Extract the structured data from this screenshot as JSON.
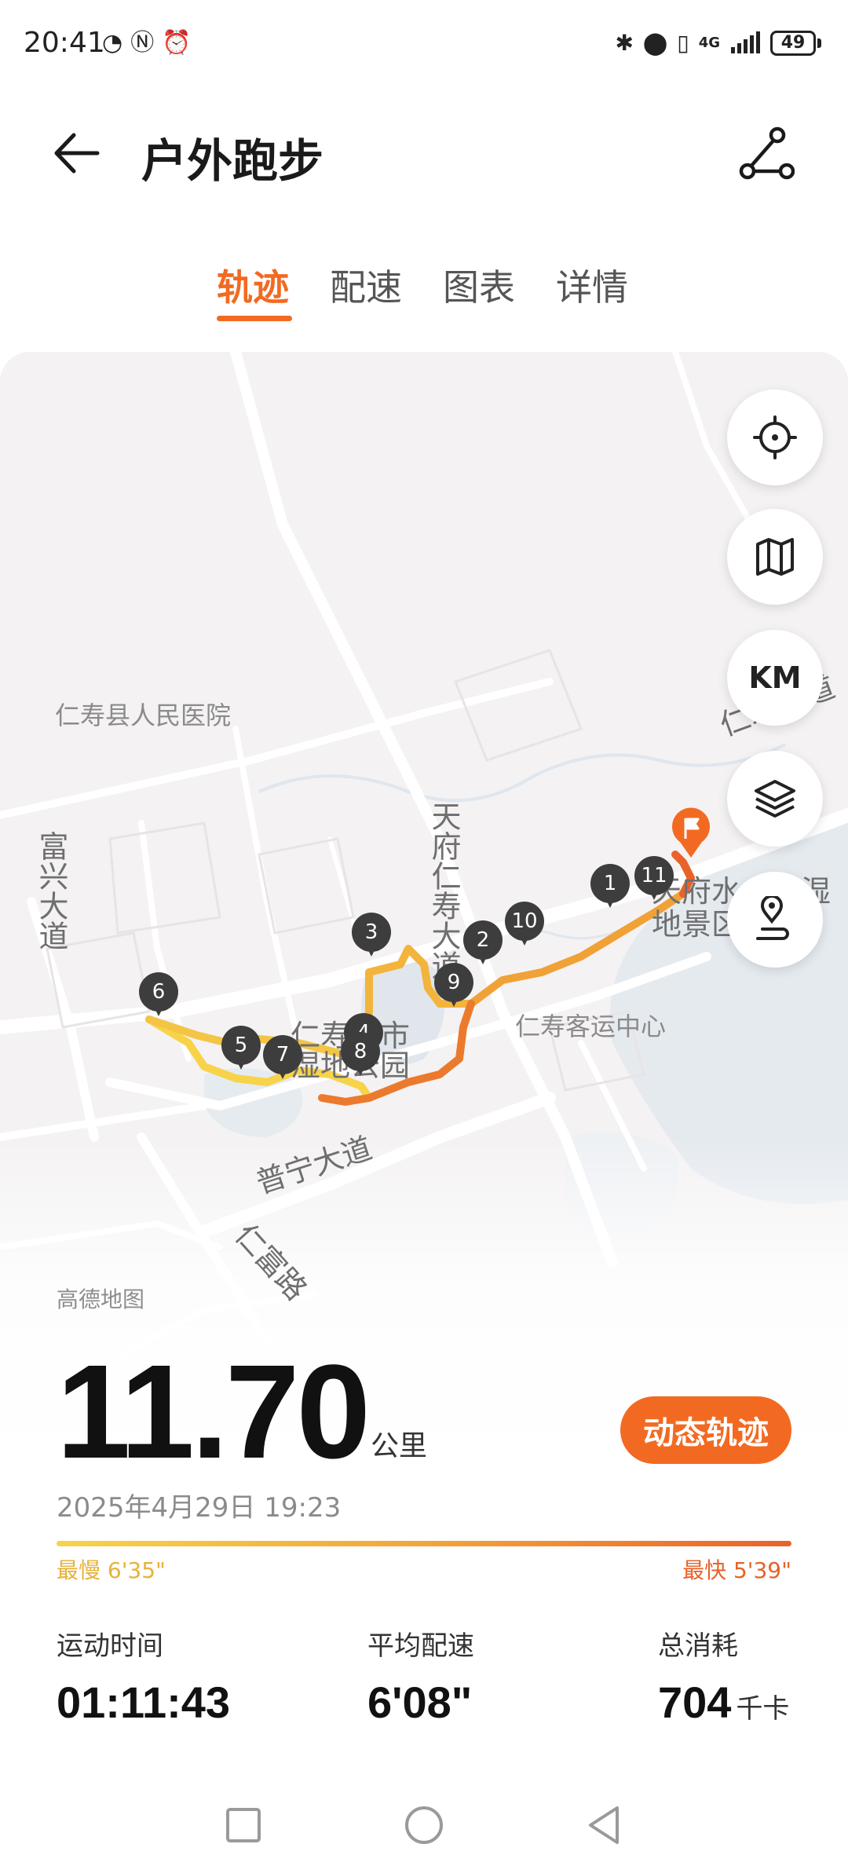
{
  "status_bar": {
    "time": "20:41",
    "network": "4G",
    "battery": "49",
    "icons": [
      "speedometer-icon",
      "nfc-icon",
      "alarm-icon",
      "bluetooth-icon",
      "location-icon",
      "vibrate-icon",
      "signal-icon"
    ]
  },
  "header": {
    "title": "户外跑步",
    "back_icon": "arrow-left-icon",
    "share_icon": "route-share-icon"
  },
  "tabs": [
    {
      "label": "轨迹",
      "active": true
    },
    {
      "label": "配速",
      "active": false
    },
    {
      "label": "图表",
      "active": false
    },
    {
      "label": "详情",
      "active": false
    }
  ],
  "map": {
    "labels": {
      "hospital": "仁寿县人民医院",
      "avenue_left": "富兴大道",
      "tianfu": "天府仁寿大道",
      "renshou_ave": "仁寿大道",
      "park": "仁寿城市湿地公园",
      "bus_center": "仁寿客运中心",
      "puning": "普宁大道",
      "renfu": "仁富路",
      "wetland": "天府水六乡湿地景区"
    },
    "attribution": "高德地图",
    "controls": [
      {
        "name": "locate-button",
        "icon": "crosshair-icon",
        "label": ""
      },
      {
        "name": "map-type-button",
        "icon": "map-icon",
        "label": ""
      },
      {
        "name": "km-button",
        "icon": "",
        "label": "KM"
      },
      {
        "name": "layers-button",
        "icon": "layers-icon",
        "label": ""
      },
      {
        "name": "route-pin-button",
        "icon": "route-pin-icon",
        "label": ""
      }
    ],
    "km_markers": [
      "1",
      "2",
      "3",
      "4",
      "5",
      "6",
      "7",
      "8",
      "9",
      "10",
      "11"
    ],
    "track_colors": {
      "slow": "#f7d34a",
      "mid": "#f3a53a",
      "fast": "#e8622a"
    }
  },
  "stats": {
    "distance": "11.70",
    "distance_unit": "公里",
    "replay_label": "动态轨迹",
    "date": "2025年4月29日 19:23",
    "pace_slowest": "最慢 6'35\"",
    "pace_fastest": "最快 5'39\"",
    "duration_label": "运动时间",
    "duration_value": "01:11:43",
    "avg_pace_label": "平均配速",
    "avg_pace_value": "6'08\"",
    "calories_label": "总消耗",
    "calories_value": "704",
    "calories_unit": "千卡"
  },
  "accent_color": "#f26a21"
}
